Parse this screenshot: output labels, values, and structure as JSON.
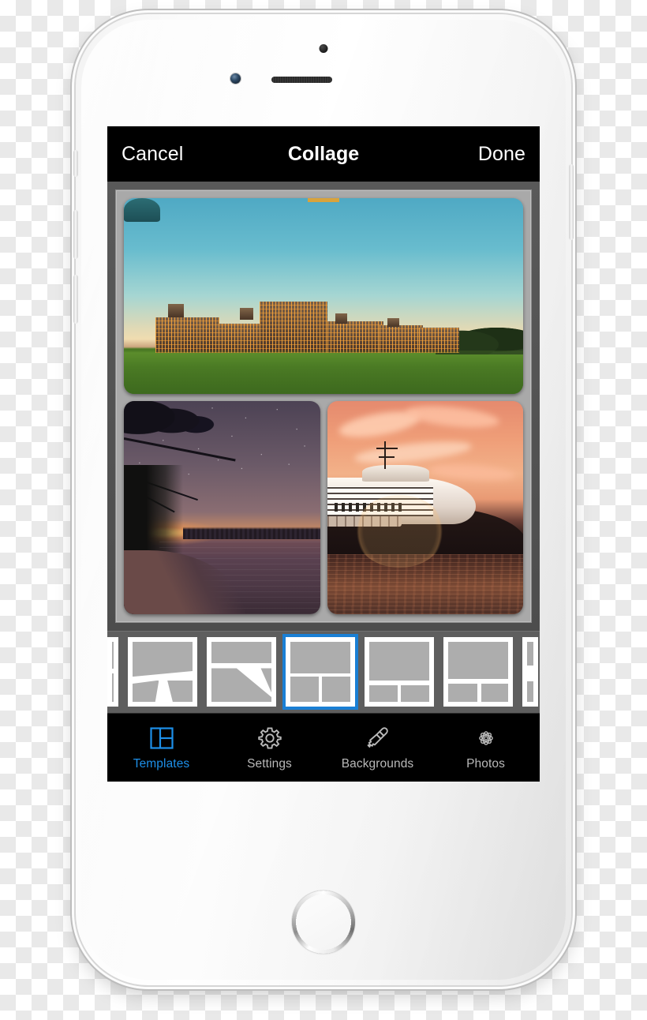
{
  "device": {
    "name": "iPhone 6 (Silver/White)",
    "body_color": "#f7f7f7",
    "screen_bg": "#000000"
  },
  "app": {
    "nav": {
      "cancel_label": "Cancel",
      "title": "Collage",
      "done_label": "Done"
    },
    "accent_color": "#1d8fe8",
    "canvas": {
      "background_color": "#a9a9a9",
      "outer_color": "#545454",
      "layout": "one-top-two-bottom",
      "cells": [
        {
          "position": "top",
          "subject": "British Columbia Parliament Buildings illuminated at dusk with green lawn",
          "palette": [
            "#53aac5",
            "#8ec9cf",
            "#e9dfb6",
            "#4d7d25",
            "#f0a93a"
          ]
        },
        {
          "position": "bottom-left",
          "subject": "Starry night sky over a calm lake with silhouetted tree branches and sunset glow",
          "palette": [
            "#4c4254",
            "#8a6d72",
            "#c88a63",
            "#3a2b35"
          ]
        },
        {
          "position": "bottom-right",
          "subject": "Cruise ship moored at sunset under dramatic pink and orange clouds",
          "palette": [
            "#e58a6e",
            "#f2b189",
            "#fdf8f2",
            "#40241f"
          ]
        }
      ]
    },
    "templates": {
      "strip_background": "#5e5e5e",
      "selected_index": 2,
      "selected_border_color": "#1a7fd4",
      "items": [
        {
          "name": "diagonal-split-three",
          "partial": "left"
        },
        {
          "name": "top-band-diagonal-two"
        },
        {
          "name": "top-band-diagonal-lower"
        },
        {
          "name": "one-top-two-bottom"
        },
        {
          "name": "large-top-two-small-bottom"
        },
        {
          "name": "large-top-two-small-bottom-alt"
        },
        {
          "name": "stacked-bands",
          "partial": "right"
        }
      ]
    },
    "tab_bar": {
      "items": [
        {
          "label": "Templates",
          "icon": "templates-icon",
          "active": true
        },
        {
          "label": "Settings",
          "icon": "gear-icon",
          "active": false
        },
        {
          "label": "Backgrounds",
          "icon": "paintbrush-icon",
          "active": false
        },
        {
          "label": "Photos",
          "icon": "photos-flower-icon",
          "active": false
        }
      ]
    }
  }
}
